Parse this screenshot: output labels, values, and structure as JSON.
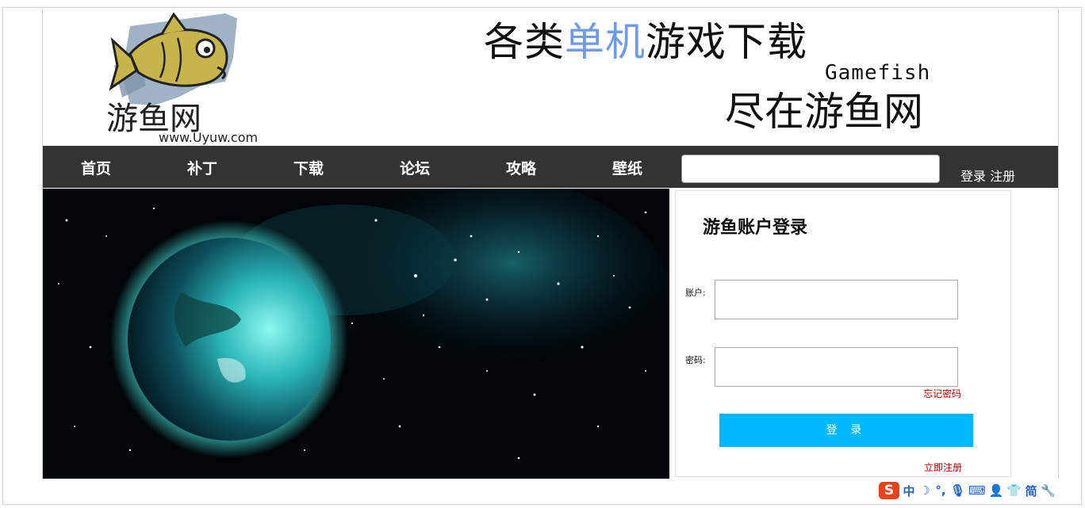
{
  "header": {
    "logo_text": "游鱼网",
    "logo_url_text": "www.Uyuw.com",
    "slogan_part1": "各类",
    "slogan_highlight": "单机",
    "slogan_part2": "游戏下载",
    "slogan_en": "Gamefish",
    "slogan_line2": "尽在游鱼网",
    "highlight_color": "#6f9be6"
  },
  "nav": {
    "items": [
      "首页",
      "补丁",
      "下载",
      "论坛",
      "攻略",
      "壁纸"
    ],
    "search_value": "",
    "login_link": "登录",
    "register_link": "注册",
    "background": "#333333"
  },
  "login_panel": {
    "title": "游鱼账户登录",
    "account_label": "账户:",
    "account_value": "",
    "password_label": "密码:",
    "password_value": "",
    "forgot_link": "忘记密码",
    "submit_label": "登 录",
    "register_link": "立即注册",
    "button_color": "#00b9ff",
    "link_color": "#c00000"
  },
  "ime_toolbar": {
    "logo": "S",
    "items": [
      "中",
      "☽",
      "°,",
      "🎙",
      "⌨",
      "👤",
      "👕",
      "简",
      "🔧"
    ]
  }
}
